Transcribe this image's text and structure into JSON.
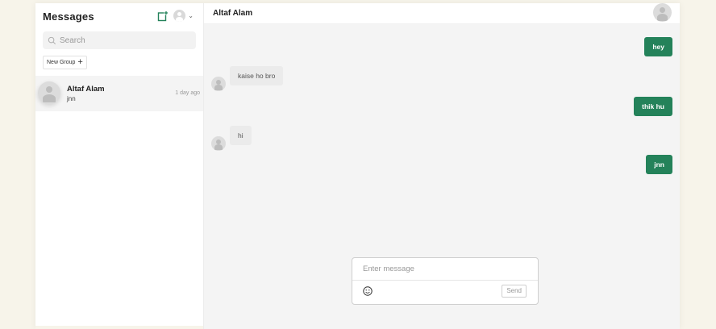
{
  "sidebar": {
    "title": "Messages",
    "search_placeholder": "Search",
    "new_group_label": "New Group",
    "conversations": [
      {
        "name": "Altaf Alam",
        "preview": "jnn",
        "time": "1 day ago"
      }
    ]
  },
  "chat": {
    "title": "Altaf Alam",
    "messages": [
      {
        "direction": "out",
        "text": "hey"
      },
      {
        "direction": "in",
        "text": "kaise ho bro"
      },
      {
        "direction": "out",
        "text": "thik hu"
      },
      {
        "direction": "in",
        "text": "hi"
      },
      {
        "direction": "out",
        "text": "jnn"
      }
    ],
    "composer": {
      "placeholder": "Enter message",
      "send_label": "Send"
    }
  },
  "colors": {
    "accent": "#24825a",
    "page_bg": "#f7f4ea"
  },
  "icons": [
    "compose-icon",
    "avatar",
    "chevron-down-icon",
    "search-icon",
    "plus-icon",
    "emoji-icon"
  ]
}
